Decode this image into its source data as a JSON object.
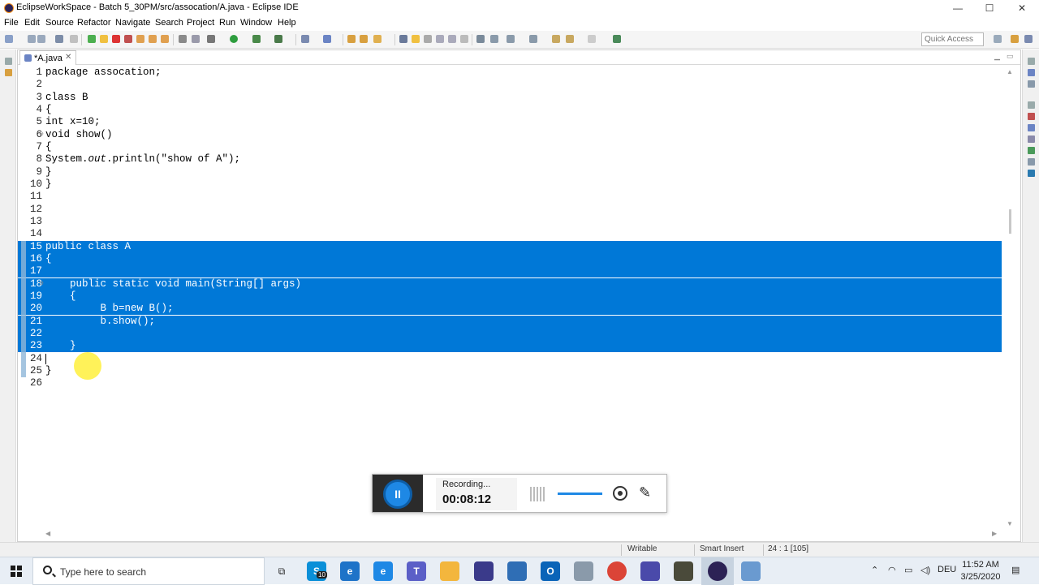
{
  "window": {
    "title": "EclipseWorkSpace - Batch 5_30PM/src/assocation/A.java - Eclipse IDE",
    "controls": {
      "minimize": "—",
      "maximize": "☐",
      "close": "✕"
    }
  },
  "menu": {
    "items": [
      "File",
      "Edit",
      "Source",
      "Refactor",
      "Navigate",
      "Search",
      "Project",
      "Run",
      "Window",
      "Help"
    ]
  },
  "toolbar": {
    "quick_access_placeholder": "Quick Access"
  },
  "editor": {
    "tab_label": "*A.java",
    "tab_close": "✕",
    "lines": [
      {
        "num": "1",
        "text": "package assocation;"
      },
      {
        "num": "2",
        "text": ""
      },
      {
        "num": "3",
        "text": "class B"
      },
      {
        "num": "4",
        "text": "{"
      },
      {
        "num": "5",
        "text": "int x=10;"
      },
      {
        "num": "6",
        "text": "void show()",
        "fold": "⊖"
      },
      {
        "num": "7",
        "text": "{"
      },
      {
        "num": "8",
        "text_pre": "System.",
        "text_it": "out",
        "text_post": ".println(\"show of A\");"
      },
      {
        "num": "9",
        "text": "}"
      },
      {
        "num": "10",
        "text": "}"
      },
      {
        "num": "11",
        "text": ""
      },
      {
        "num": "12",
        "text": ""
      },
      {
        "num": "13",
        "text": ""
      },
      {
        "num": "14",
        "text": ""
      },
      {
        "num": "15",
        "text": "public class A",
        "selected": true
      },
      {
        "num": "16",
        "text": "{",
        "selected": true
      },
      {
        "num": "17",
        "text": "",
        "selected": true
      },
      {
        "num": "18",
        "text": "    public static void main(String[] args)",
        "selected": true,
        "fold": "⊖"
      },
      {
        "num": "19",
        "text": "    {",
        "selected": true
      },
      {
        "num": "20",
        "text": "         B b=new B();",
        "selected": true
      },
      {
        "num": "21",
        "text": "         b.show();",
        "selected": true
      },
      {
        "num": "22",
        "text": "",
        "selected": true
      },
      {
        "num": "23",
        "text": "    }",
        "selected": true
      },
      {
        "num": "24",
        "text": ""
      },
      {
        "num": "25",
        "text": "}"
      },
      {
        "num": "26",
        "text": ""
      }
    ]
  },
  "status": {
    "writable": "Writable",
    "insert_mode": "Smart Insert",
    "position": "24 : 1 [105]"
  },
  "recorder": {
    "status": "Recording...",
    "time": "00:08:12",
    "pause_glyph": "II",
    "pen_glyph": "✎"
  },
  "taskbar": {
    "search_placeholder": "Type here to search",
    "skype_badge": "10",
    "language": "DEU",
    "time": "11:52 AM",
    "date": "3/25/2020",
    "colors": {
      "edge": "#1e73c8",
      "teams": "#5b5fc7",
      "explorer": "#f3b63d",
      "chrome": "#db4437",
      "eclipse": "#2c2255"
    }
  }
}
